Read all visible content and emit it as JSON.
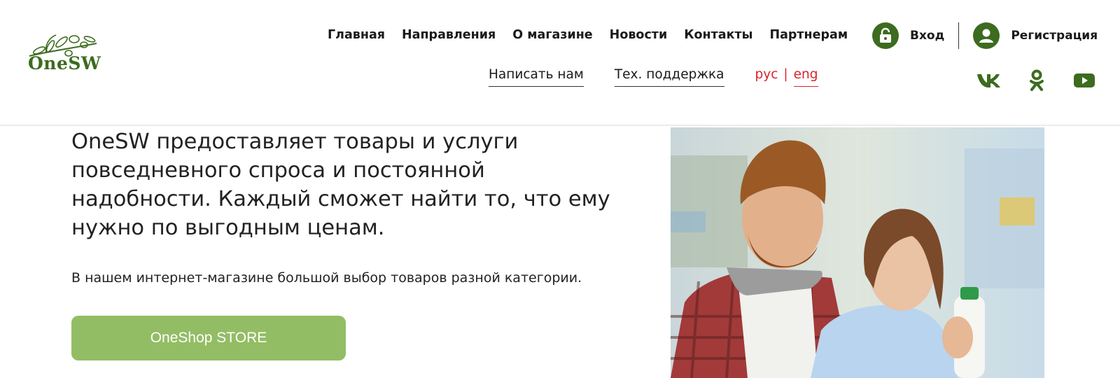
{
  "brand": {
    "name": "OneSW"
  },
  "nav": {
    "main": [
      "Главная",
      "Направления",
      "О магазине",
      "Новости",
      "Контакты",
      "Партнерам"
    ],
    "secondary": [
      "Написать нам",
      "Тех. поддержка"
    ]
  },
  "language": {
    "ru": "рус",
    "separator": "|",
    "en": "eng"
  },
  "auth": {
    "login": "Вход",
    "register": "Регистрация"
  },
  "social": [
    "vk-icon",
    "odnoklassniki-icon",
    "youtube-icon"
  ],
  "hero": {
    "title": "OneSW предоставляет товары и услуги повседневного спроса и постоянной надобности. Каждый сможет найти то, что ему нужно по выгодным ценам.",
    "text": "В нашем интернет-магазине большой выбор товаров разной категории.",
    "cta": "OneShop STORE"
  },
  "colors": {
    "brand_green": "#3d6b1f",
    "cta_green": "#93bd64",
    "accent_red": "#d9232d"
  }
}
